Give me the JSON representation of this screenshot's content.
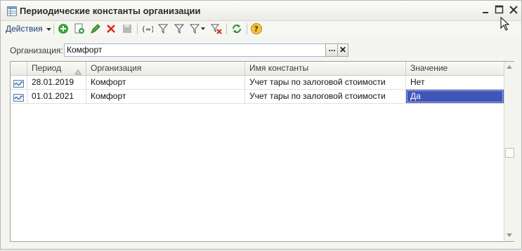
{
  "window": {
    "title": "Периодические константы организации",
    "controls": [
      "minimize-icon",
      "maximize-icon",
      "close-icon"
    ]
  },
  "toolbar": {
    "actions_label": "Действия",
    "buttons": [
      "add-icon",
      "copy-icon",
      "edit-icon",
      "delete-icon",
      "save-icon",
      "interval-icon",
      "filter-icon",
      "filter-clear-icon",
      "filter-dropdown-icon",
      "filter-remove-icon",
      "refresh-icon",
      "help-icon"
    ]
  },
  "filter": {
    "label": "Организация:",
    "value": "Комфорт",
    "choose_label": "...",
    "clear_label": "✕"
  },
  "table": {
    "columns": [
      "Период",
      "Организация",
      "Имя константы",
      "Значение"
    ],
    "rows": [
      {
        "period": "28.01.2019",
        "organization": "Комфорт",
        "constant": "Учет тары по залоговой стоимости",
        "value": "Нет"
      },
      {
        "period": "01.01.2021",
        "organization": "Комфорт",
        "constant": "Учет тары по залоговой стоимости",
        "value": "Да"
      }
    ]
  },
  "colors": {
    "selection": "#3f55b8",
    "link": "#1a3d72"
  }
}
